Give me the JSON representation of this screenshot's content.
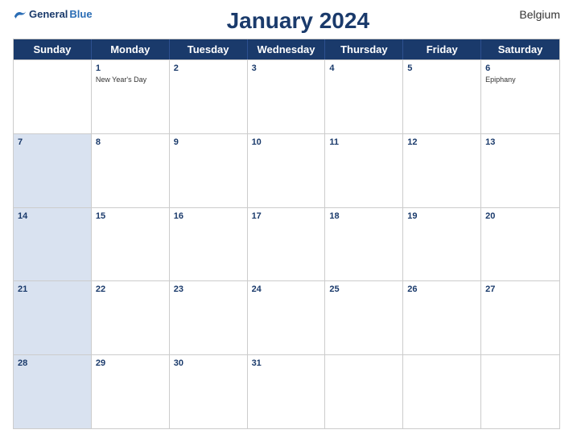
{
  "header": {
    "logo_general": "General",
    "logo_blue": "Blue",
    "title": "January 2024",
    "country": "Belgium"
  },
  "day_headers": [
    "Sunday",
    "Monday",
    "Tuesday",
    "Wednesday",
    "Thursday",
    "Friday",
    "Saturday"
  ],
  "weeks": [
    [
      {
        "num": "",
        "holiday": "",
        "dark": false,
        "empty": true
      },
      {
        "num": "1",
        "holiday": "New Year's Day",
        "dark": false
      },
      {
        "num": "2",
        "holiday": "",
        "dark": false
      },
      {
        "num": "3",
        "holiday": "",
        "dark": false
      },
      {
        "num": "4",
        "holiday": "",
        "dark": false
      },
      {
        "num": "5",
        "holiday": "",
        "dark": false
      },
      {
        "num": "6",
        "holiday": "Epiphany",
        "dark": false
      }
    ],
    [
      {
        "num": "7",
        "holiday": "",
        "dark": true
      },
      {
        "num": "8",
        "holiday": "",
        "dark": false
      },
      {
        "num": "9",
        "holiday": "",
        "dark": false
      },
      {
        "num": "10",
        "holiday": "",
        "dark": false
      },
      {
        "num": "11",
        "holiday": "",
        "dark": false
      },
      {
        "num": "12",
        "holiday": "",
        "dark": false
      },
      {
        "num": "13",
        "holiday": "",
        "dark": false
      }
    ],
    [
      {
        "num": "14",
        "holiday": "",
        "dark": true
      },
      {
        "num": "15",
        "holiday": "",
        "dark": false
      },
      {
        "num": "16",
        "holiday": "",
        "dark": false
      },
      {
        "num": "17",
        "holiday": "",
        "dark": false
      },
      {
        "num": "18",
        "holiday": "",
        "dark": false
      },
      {
        "num": "19",
        "holiday": "",
        "dark": false
      },
      {
        "num": "20",
        "holiday": "",
        "dark": false
      }
    ],
    [
      {
        "num": "21",
        "holiday": "",
        "dark": true
      },
      {
        "num": "22",
        "holiday": "",
        "dark": false
      },
      {
        "num": "23",
        "holiday": "",
        "dark": false
      },
      {
        "num": "24",
        "holiday": "",
        "dark": false
      },
      {
        "num": "25",
        "holiday": "",
        "dark": false
      },
      {
        "num": "26",
        "holiday": "",
        "dark": false
      },
      {
        "num": "27",
        "holiday": "",
        "dark": false
      }
    ],
    [
      {
        "num": "28",
        "holiday": "",
        "dark": true
      },
      {
        "num": "29",
        "holiday": "",
        "dark": false
      },
      {
        "num": "30",
        "holiday": "",
        "dark": false
      },
      {
        "num": "31",
        "holiday": "",
        "dark": false
      },
      {
        "num": "",
        "holiday": "",
        "dark": false,
        "empty": true
      },
      {
        "num": "",
        "holiday": "",
        "dark": false,
        "empty": true
      },
      {
        "num": "",
        "holiday": "",
        "dark": false,
        "empty": true
      }
    ]
  ]
}
